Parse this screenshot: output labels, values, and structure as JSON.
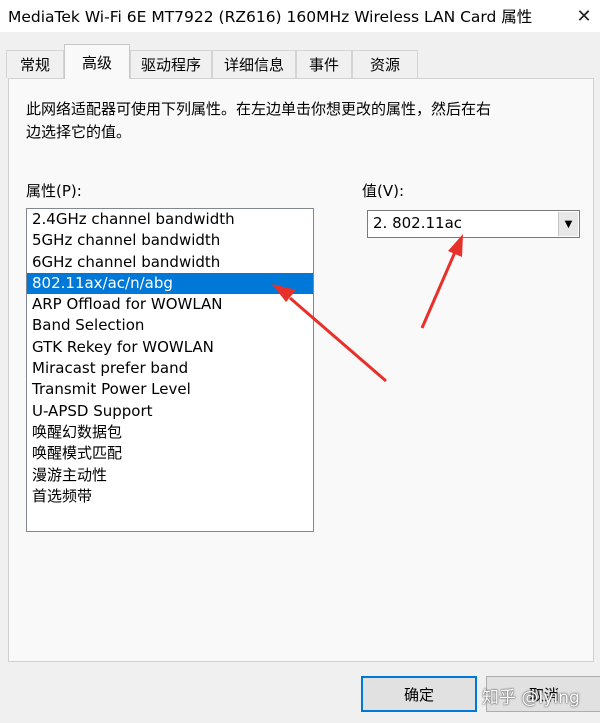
{
  "window": {
    "title": "MediaTek Wi-Fi 6E MT7922 (RZ616) 160MHz Wireless LAN Card 属性",
    "close_glyph": "✕"
  },
  "tabs": [
    {
      "label": "常规",
      "active": false
    },
    {
      "label": "高级",
      "active": true
    },
    {
      "label": "驱动程序",
      "active": false
    },
    {
      "label": "详细信息",
      "active": false
    },
    {
      "label": "事件",
      "active": false
    },
    {
      "label": "资源",
      "active": false
    }
  ],
  "advanced": {
    "description_line1": "此网络适配器可使用下列属性。在左边单击你想更改的属性，然后在右",
    "description_line2": "边选择它的值。",
    "property_label": "属性(P):",
    "value_label": "值(V):",
    "properties": [
      "2.4GHz channel bandwidth",
      "5GHz channel bandwidth",
      "6GHz channel bandwidth",
      "802.11ax/ac/n/abg",
      "ARP Offload for WOWLAN",
      "Band Selection",
      "GTK Rekey for WOWLAN",
      "Miracast prefer band",
      "Transmit Power Level",
      "U-APSD Support",
      "唤醒幻数据包",
      "唤醒模式匹配",
      "漫游主动性",
      "首选频带"
    ],
    "selected_property": "802.11ax/ac/n/abg",
    "value_selected": "2. 802.11ac",
    "dropdown_icon": "chevron-down-icon"
  },
  "buttons": {
    "ok_label": "确定",
    "cancel_label": "取消"
  },
  "watermark": "知乎 @Iying",
  "colors": {
    "selection": "#0078d7",
    "arrow": "#e8302a"
  }
}
